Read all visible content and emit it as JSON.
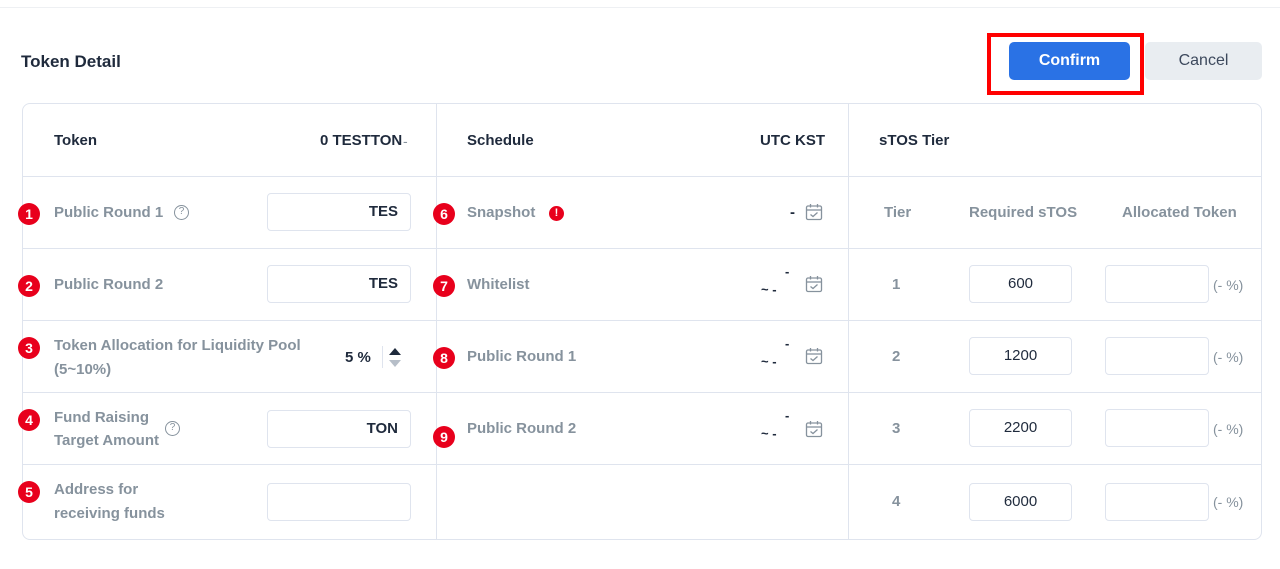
{
  "header": {
    "title": "Token Detail",
    "confirm_label": "Confirm",
    "cancel_label": "Cancel"
  },
  "token_column": {
    "heading": "Token",
    "summary": "0 TESTTON",
    "summary_suffix": "-",
    "rows": [
      {
        "number": "1",
        "label": "Public Round 1",
        "value": "TES"
      },
      {
        "number": "2",
        "label": "Public Round 2",
        "value": "TES"
      },
      {
        "number": "3",
        "label_line1": "Token Allocation for Liquidity Pool",
        "label_line2": "(5~10%)",
        "value": "5 %"
      },
      {
        "number": "4",
        "label_line1": "Fund Raising",
        "label_line2": "Target Amount",
        "value": "TON"
      },
      {
        "number": "5",
        "label_line1": "Address for",
        "label_line2": "receiving funds",
        "value": ""
      }
    ]
  },
  "schedule_column": {
    "heading": "Schedule",
    "timezone": "UTC KST",
    "rows": [
      {
        "number": "6",
        "label": "Snapshot",
        "date": "-"
      },
      {
        "number": "7",
        "label": "Whitelist",
        "start": "-",
        "end": "~ -"
      },
      {
        "number": "8",
        "label": "Public Round 1",
        "start": "-",
        "end": "~ -"
      },
      {
        "number": "9",
        "label": "Public Round 2",
        "start": "-",
        "end": "~ -"
      }
    ]
  },
  "tier_column": {
    "heading": "sTOS Tier",
    "col_tier": "Tier",
    "col_required": "Required sTOS",
    "col_allocated": "Allocated Token",
    "rows": [
      {
        "tier": "1",
        "required": "600",
        "percent": "(- %)"
      },
      {
        "tier": "2",
        "required": "1200",
        "percent": "(- %)"
      },
      {
        "tier": "3",
        "required": "2200",
        "percent": "(- %)"
      },
      {
        "tier": "4",
        "required": "6000",
        "percent": "(- %)"
      }
    ]
  },
  "icons": {
    "help": "?",
    "warning": "!"
  },
  "colors": {
    "primary": "#2a72e5",
    "badge": "#e8001c",
    "highlight": "#ff0000"
  }
}
